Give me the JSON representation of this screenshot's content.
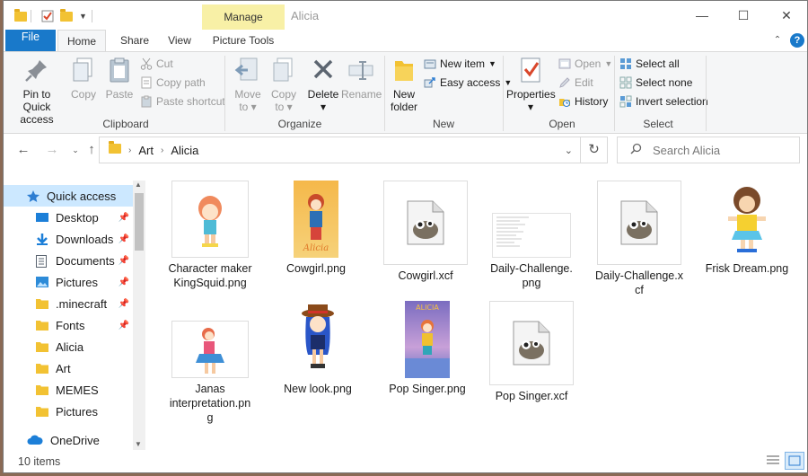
{
  "window": {
    "title": "Alicia",
    "contextual_tab": "Manage"
  },
  "tabs": {
    "file": "File",
    "home": "Home",
    "share": "Share",
    "view": "View",
    "picture_tools": "Picture Tools"
  },
  "ribbon": {
    "clipboard": {
      "label": "Clipboard",
      "pin_line1": "Pin to Quick",
      "pin_line2": "access",
      "copy": "Copy",
      "paste": "Paste",
      "cut": "Cut",
      "copy_path": "Copy path",
      "paste_shortcut": "Paste shortcut"
    },
    "organize": {
      "label": "Organize",
      "move_to": "Move",
      "move_to2": "to",
      "copy_to": "Copy",
      "copy_to2": "to",
      "delete": "Delete",
      "rename": "Rename"
    },
    "new": {
      "label": "New",
      "new_folder1": "New",
      "new_folder2": "folder",
      "new_item": "New item",
      "easy_access": "Easy access"
    },
    "open": {
      "label": "Open",
      "properties": "Properties",
      "open": "Open",
      "edit": "Edit",
      "history": "History"
    },
    "select": {
      "label": "Select",
      "select_all": "Select all",
      "select_none": "Select none",
      "invert": "Invert selection"
    }
  },
  "address": {
    "crumbs": [
      "Art",
      "Alicia"
    ],
    "search_placeholder": "Search Alicia"
  },
  "sidebar": {
    "items": [
      {
        "label": "Quick access",
        "icon": "star-icon"
      },
      {
        "label": "Desktop",
        "icon": "desktop-icon",
        "pinned": true
      },
      {
        "label": "Downloads",
        "icon": "download-icon",
        "pinned": true
      },
      {
        "label": "Documents",
        "icon": "documents-icon",
        "pinned": true
      },
      {
        "label": "Pictures",
        "icon": "pictures-icon",
        "pinned": true
      },
      {
        "label": ".minecraft",
        "icon": "folder-icon",
        "pinned": true
      },
      {
        "label": "Fonts",
        "icon": "folder-icon",
        "pinned": true
      },
      {
        "label": "Alicia",
        "icon": "folder-icon"
      },
      {
        "label": "Art",
        "icon": "folder-icon"
      },
      {
        "label": "MEMES",
        "icon": "folder-icon"
      },
      {
        "label": "Pictures",
        "icon": "folder-icon"
      },
      {
        "label": "OneDrive",
        "icon": "cloud-icon"
      }
    ]
  },
  "files": [
    {
      "line1": "Character maker",
      "line2": "KingSquid.png",
      "line3": ""
    },
    {
      "line1": "Cowgirl.png",
      "line2": "",
      "line3": ""
    },
    {
      "line1": "Cowgirl.xcf",
      "line2": "",
      "line3": ""
    },
    {
      "line1": "Daily-Challenge.",
      "line2": "png",
      "line3": ""
    },
    {
      "line1": "Daily-Challenge.x",
      "line2": "cf",
      "line3": ""
    },
    {
      "line1": "Frisk Dream.png",
      "line2": "",
      "line3": ""
    },
    {
      "line1": "Janas",
      "line2": "interpretation.pn",
      "line3": "g"
    },
    {
      "line1": "New look.png",
      "line2": "",
      "line3": ""
    },
    {
      "line1": "Pop Singer.png",
      "line2": "",
      "line3": ""
    },
    {
      "line1": "Pop Singer.xcf",
      "line2": "",
      "line3": ""
    }
  ],
  "status": {
    "count": "10 items"
  },
  "colors": {
    "accent": "#1979ca",
    "selection": "#cce8ff",
    "manage_tab": "#f8f0a6"
  }
}
